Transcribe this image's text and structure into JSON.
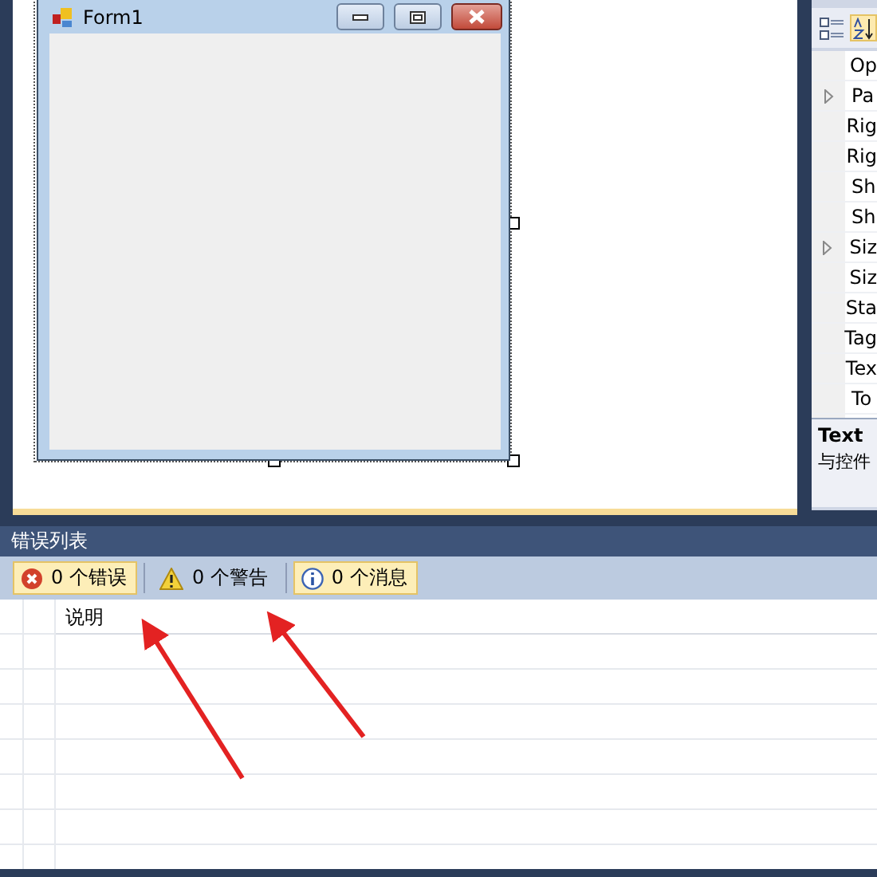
{
  "designer": {
    "form": {
      "title": "Form1"
    }
  },
  "properties": {
    "rows": [
      {
        "name": "Op",
        "expandable": false
      },
      {
        "name": "Pa",
        "expandable": true
      },
      {
        "name": "Rig",
        "expandable": false
      },
      {
        "name": "Rig",
        "expandable": false
      },
      {
        "name": "Sh",
        "expandable": false
      },
      {
        "name": "Sh",
        "expandable": false
      },
      {
        "name": "Siz",
        "expandable": true
      },
      {
        "name": "Siz",
        "expandable": false
      },
      {
        "name": "Sta",
        "expandable": false
      },
      {
        "name": "Tag",
        "expandable": false
      },
      {
        "name": "Tex",
        "expandable": false
      },
      {
        "name": "To",
        "expandable": false
      }
    ],
    "description": {
      "title": "Text",
      "text": "与控件"
    }
  },
  "error_list": {
    "title": "错误列表",
    "filters": [
      {
        "kind": "error",
        "label": "0 个错误",
        "selected": true
      },
      {
        "kind": "warning",
        "label": "0 个警告",
        "selected": false
      },
      {
        "kind": "message",
        "label": "0 个消息",
        "selected": true
      }
    ],
    "columns": [
      "说明"
    ]
  }
}
